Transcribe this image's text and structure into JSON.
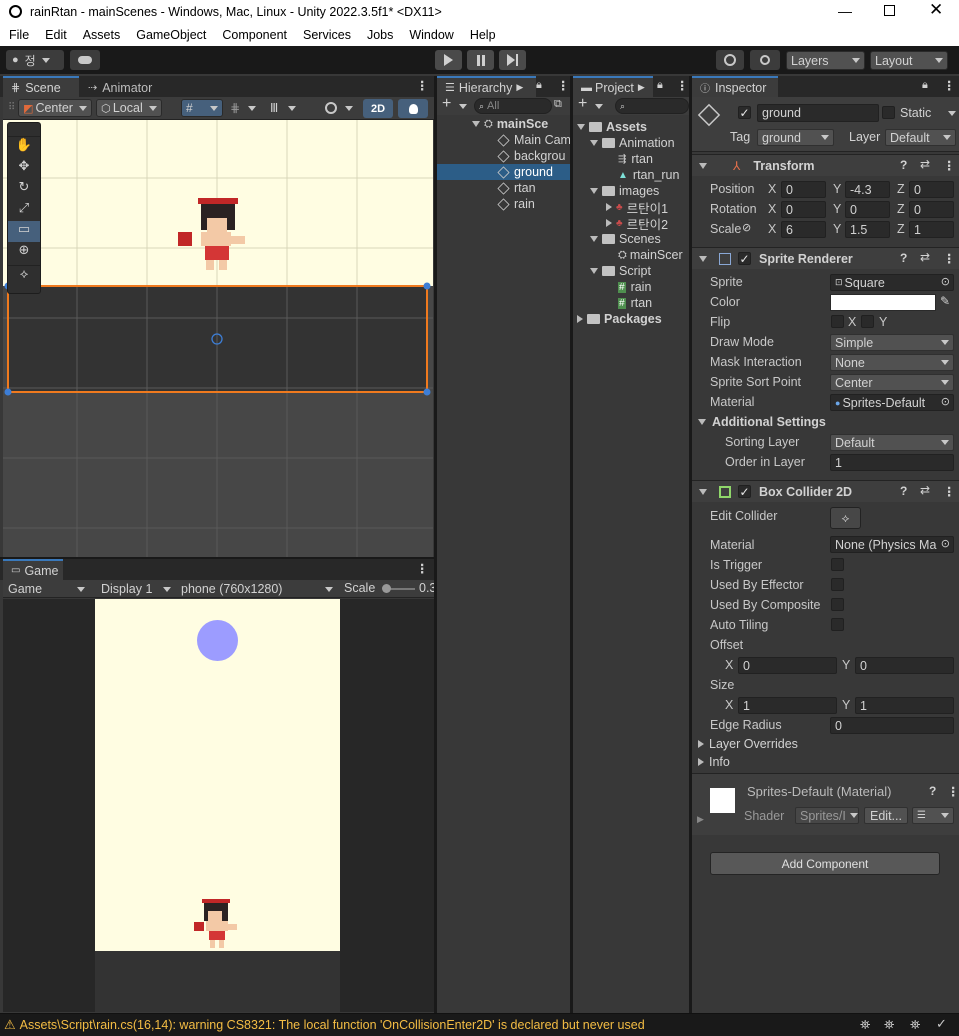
{
  "window": {
    "title": "rainRtan - mainScenes - Windows, Mac, Linux - Unity 2022.3.5f1* <DX11>"
  },
  "menu": [
    "File",
    "Edit",
    "Assets",
    "GameObject",
    "Component",
    "Services",
    "Jobs",
    "Window",
    "Help"
  ],
  "toolbar": {
    "account": "정",
    "layers": "Layers",
    "layout": "Layout"
  },
  "scene": {
    "tabs": [
      "Scene",
      "Animator"
    ],
    "pivot": "Center",
    "space": "Local",
    "mode2d": "2D"
  },
  "game": {
    "tab": "Game",
    "view": "Game",
    "display": "Display 1",
    "resolution": "phone (760x1280)",
    "scale_label": "Scale",
    "scale_value": "0.3"
  },
  "hierarchy": {
    "tab": "Hierarchy",
    "search_placeholder": "All",
    "root": "mainSce",
    "items": [
      "Main Cam",
      "backgrou",
      "ground",
      "rtan",
      "rain"
    ],
    "selected": "ground"
  },
  "project": {
    "tab": "Project",
    "assets": "Assets",
    "animation": "Animation",
    "rtan_clip": "rtan",
    "rtan_run": "rtan_run",
    "images": "images",
    "img1": "르탄이1",
    "img2": "르탄이2",
    "scenes": "Scenes",
    "scene_file": "mainScer",
    "script": "Script",
    "script_rain": "rain",
    "script_rtan": "rtan",
    "packages": "Packages"
  },
  "inspector": {
    "tab": "Inspector",
    "object_name": "ground",
    "static_label": "Static",
    "tag_label": "Tag",
    "tag": "ground",
    "layer_label": "Layer",
    "layer": "Default",
    "transform": {
      "title": "Transform",
      "position_label": "Position",
      "rotation_label": "Rotation",
      "scale_label": "Scale",
      "position": {
        "x": "0",
        "y": "-4.3",
        "z": "0"
      },
      "rotation": {
        "x": "0",
        "y": "0",
        "z": "0"
      },
      "scale": {
        "x": "6",
        "y": "1.5",
        "z": "1"
      }
    },
    "sprite_renderer": {
      "title": "Sprite Renderer",
      "sprite_label": "Sprite",
      "sprite": "Square",
      "color_label": "Color",
      "flip_label": "Flip",
      "flip_x": "X",
      "flip_y": "Y",
      "draw_mode_label": "Draw Mode",
      "draw_mode": "Simple",
      "mask_label": "Mask Interaction",
      "mask": "None",
      "sort_point_label": "Sprite Sort Point",
      "sort_point": "Center",
      "material_label": "Material",
      "material": "Sprites-Default",
      "additional": "Additional Settings",
      "sorting_layer_label": "Sorting Layer",
      "sorting_layer": "Default",
      "order_label": "Order in Layer",
      "order": "1"
    },
    "box_collider": {
      "title": "Box Collider 2D",
      "edit_label": "Edit Collider",
      "material_label": "Material",
      "material": "None (Physics Ma",
      "trigger_label": "Is Trigger",
      "effector_label": "Used By Effector",
      "composite_label": "Used By Composite",
      "tiling_label": "Auto Tiling",
      "offset_label": "Offset",
      "offset_x": "0",
      "offset_y": "0",
      "size_label": "Size",
      "size_x": "1",
      "size_y": "1",
      "edge_label": "Edge Radius",
      "edge": "0",
      "layer_overrides": "Layer Overrides",
      "info": "Info"
    },
    "material_block": {
      "name": "Sprites-Default (Material)",
      "shader_label": "Shader",
      "shader": "Sprites/I",
      "edit": "Edit..."
    },
    "add_component": "Add Component"
  },
  "status": {
    "warning": "Assets\\Script\\rain.cs(16,14): warning CS8321: The local function 'OnCollisionEnter2D' is declared but never used"
  },
  "colors": {
    "accent": "#3a79bb",
    "selection": "#2c5d87",
    "scene_bg": "#fffde2",
    "warning": "#f4bd44"
  }
}
